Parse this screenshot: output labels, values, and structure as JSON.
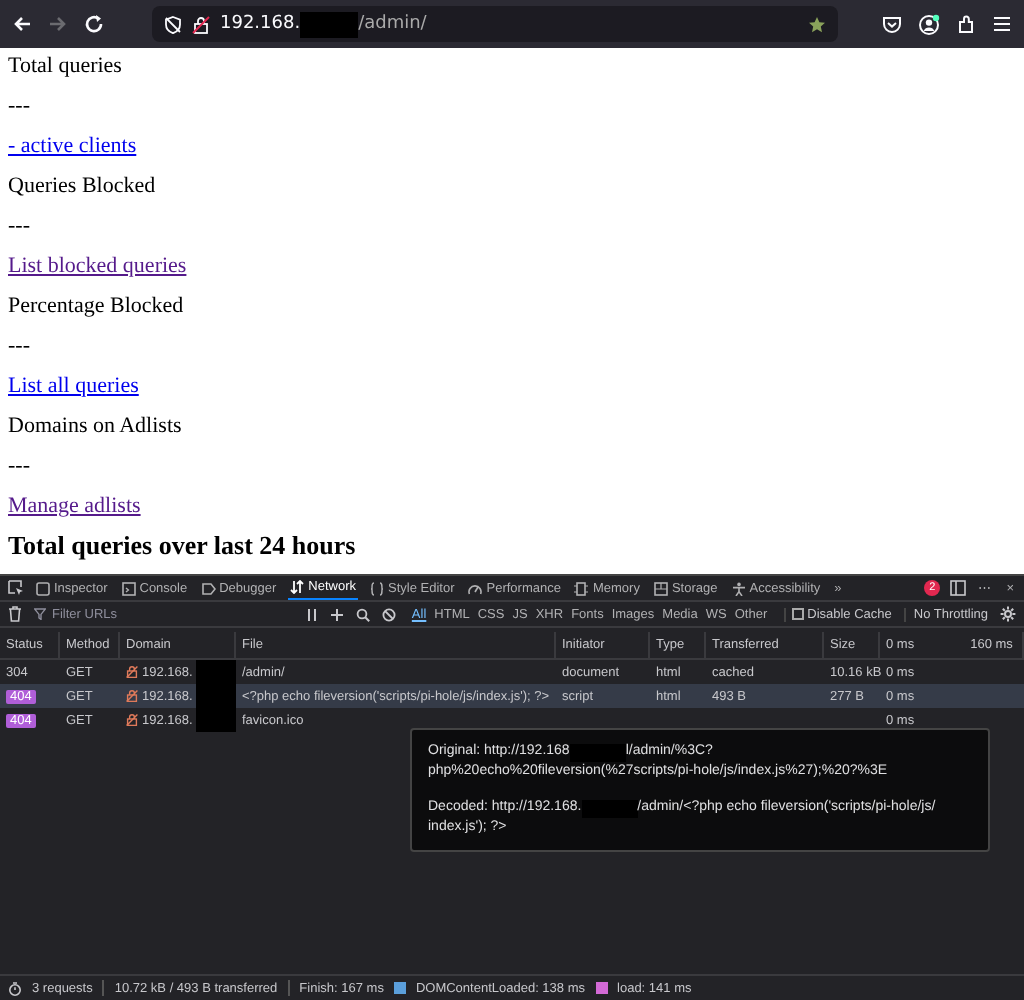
{
  "browser": {
    "forward": {
      "disabled": true
    },
    "url": {
      "host": "192.168.",
      "path": "/admin/"
    }
  },
  "page": {
    "items": [
      {
        "kind": "text",
        "text": "Total queries"
      },
      {
        "kind": "text",
        "text": "---"
      },
      {
        "kind": "link",
        "text": "- active clients",
        "visited": false
      },
      {
        "kind": "text",
        "text": "Queries Blocked"
      },
      {
        "kind": "text",
        "text": "---"
      },
      {
        "kind": "link",
        "text": "List blocked queries",
        "visited": true
      },
      {
        "kind": "text",
        "text": "Percentage Blocked"
      },
      {
        "kind": "text",
        "text": "---"
      },
      {
        "kind": "link",
        "text": "List all queries",
        "visited": false
      },
      {
        "kind": "text",
        "text": "Domains on Adlists"
      },
      {
        "kind": "text",
        "text": "---"
      },
      {
        "kind": "link",
        "text": "Manage adlists",
        "visited": true
      },
      {
        "kind": "heading",
        "text": "Total queries over last 24 hours"
      }
    ]
  },
  "devtools": {
    "tabs": [
      {
        "label": "Inspector",
        "selected": false
      },
      {
        "label": "Console",
        "selected": false
      },
      {
        "label": "Debugger",
        "selected": false
      },
      {
        "label": "Network",
        "selected": true
      },
      {
        "label": "Style Editor",
        "selected": false
      },
      {
        "label": "Performance",
        "selected": false
      },
      {
        "label": "Memory",
        "selected": false
      },
      {
        "label": "Storage",
        "selected": false
      },
      {
        "label": "Accessibility",
        "selected": false
      }
    ],
    "overflow": "»",
    "error_count": "2",
    "more": "⋯",
    "close": "×",
    "filter": {
      "placeholder": "Filter URLs"
    },
    "type_filters": [
      {
        "label": "All",
        "selected": true
      },
      {
        "label": "HTML",
        "selected": false
      },
      {
        "label": "CSS",
        "selected": false
      },
      {
        "label": "JS",
        "selected": false
      },
      {
        "label": "XHR",
        "selected": false
      },
      {
        "label": "Fonts",
        "selected": false
      },
      {
        "label": "Images",
        "selected": false
      },
      {
        "label": "Media",
        "selected": false
      },
      {
        "label": "WS",
        "selected": false
      },
      {
        "label": "Other",
        "selected": false
      }
    ],
    "disable_cache": {
      "label": "Disable Cache",
      "checked": false
    },
    "throttling": {
      "value": "No Throttling"
    },
    "table": {
      "columns": [
        "Status",
        "Method",
        "Domain",
        "File",
        "Initiator",
        "Type",
        "Transferred",
        "Size"
      ],
      "timeline_ticks": [
        "0 ms",
        "160 ms"
      ],
      "rows": [
        {
          "status": "304",
          "error": false,
          "method": "GET",
          "domain": "192.168.",
          "file": "/admin/",
          "initiator": "document",
          "type": "html",
          "transferred": "cached",
          "size": "10.16 kB",
          "timing": "0 ms",
          "selected": false
        },
        {
          "status": "404",
          "error": true,
          "method": "GET",
          "domain": "192.168.",
          "file": "<?php echo fileversion('scripts/pi-hole/js/index.js'); ?>",
          "initiator": "script",
          "type": "html",
          "transferred": "493 B",
          "size": "277 B",
          "timing": "0 ms",
          "selected": true
        },
        {
          "status": "404",
          "error": true,
          "method": "GET",
          "domain": "192.168.",
          "file": "favicon.ico",
          "timing": "0 ms",
          "selected": false
        }
      ]
    },
    "tooltip": {
      "original_label": "Original: http://192.168",
      "original_rest": "l/admin/%3C?",
      "original_continuation": "php%20echo%20fileversion(%27scripts/pi-hole/js/index.js%27);%20?%3E",
      "decoded_label": "Decoded: http://192.168.",
      "decoded_rest": "/admin/<?php echo fileversion('scripts/pi-hole/js/",
      "decoded_continuation": "index.js'); ?>"
    },
    "status_bar": {
      "requests": "3 requests",
      "transferred": "10.72 kB / 493 B transferred",
      "finish": "Finish: 167 ms",
      "dom_content_loaded": "DOMContentLoaded: 138 ms",
      "load": "load: 141 ms"
    }
  }
}
